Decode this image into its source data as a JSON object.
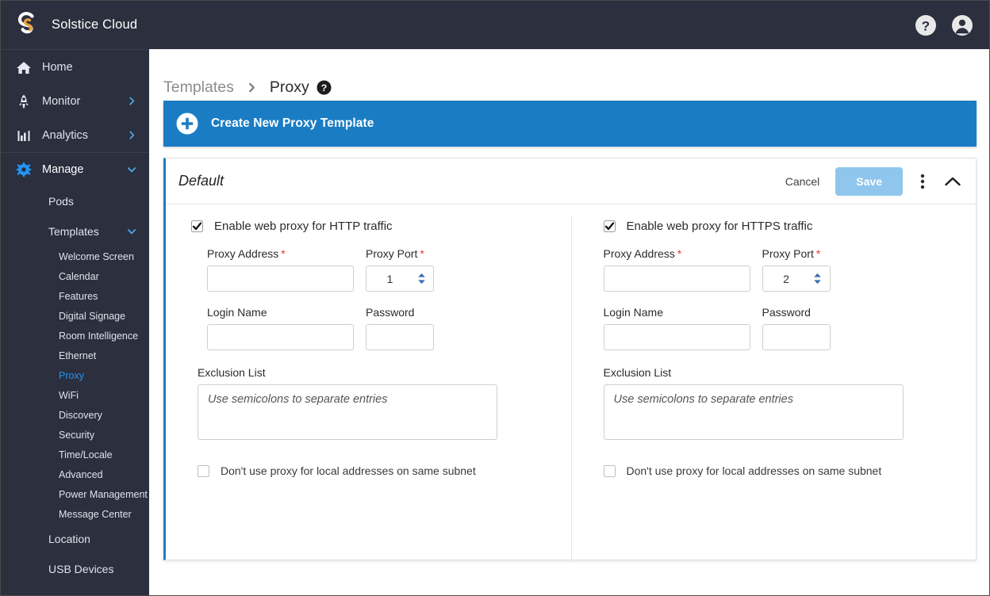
{
  "app": {
    "brand_name": "Solstice Cloud",
    "logo_icon": "solstice-s-logo",
    "help_icon": "question-circle-icon",
    "account_icon": "user-account-icon"
  },
  "colors": {
    "sidebar_bg": "#2b2f3e",
    "accent_blue": "#1a7dc4",
    "link_blue": "#2196f3",
    "save_blue": "#90c6ed",
    "required_red": "#e53935",
    "logo_orange": "#e8a33d"
  },
  "sidebar": {
    "items": [
      {
        "label": "Home",
        "icon": "home-icon",
        "caret": "none",
        "level": "top"
      },
      {
        "label": "Monitor",
        "icon": "rocket-icon",
        "caret": "right",
        "level": "top"
      },
      {
        "label": "Analytics",
        "icon": "bar-chart-icon",
        "caret": "right",
        "level": "top"
      },
      {
        "label": "Manage",
        "icon": "gear-icon",
        "caret": "down",
        "level": "top"
      }
    ],
    "manage_children": [
      {
        "label": "Pods",
        "caret": "none"
      },
      {
        "label": "Templates",
        "caret": "down"
      }
    ],
    "template_children": [
      {
        "label": "Welcome Screen",
        "selected": false
      },
      {
        "label": "Calendar",
        "selected": false
      },
      {
        "label": "Features",
        "selected": false
      },
      {
        "label": "Digital Signage",
        "selected": false
      },
      {
        "label": "Room Intelligence",
        "selected": false
      },
      {
        "label": "Ethernet",
        "selected": false
      },
      {
        "label": "Proxy",
        "selected": true
      },
      {
        "label": "WiFi",
        "selected": false
      },
      {
        "label": "Discovery",
        "selected": false
      },
      {
        "label": "Security",
        "selected": false
      },
      {
        "label": "Time/Locale",
        "selected": false
      },
      {
        "label": "Advanced",
        "selected": false
      },
      {
        "label": "Power Management",
        "selected": false
      },
      {
        "label": "Message Center",
        "selected": false
      }
    ],
    "manage_children_tail": [
      {
        "label": "Location"
      },
      {
        "label": "USB Devices"
      }
    ]
  },
  "breadcrumb": {
    "parent": "Templates",
    "separator_icon": "chevron-right-icon",
    "current": "Proxy",
    "help_icon": "help-question-icon"
  },
  "create_banner": {
    "label": "Create New Proxy Template",
    "icon": "plus-circle-icon"
  },
  "card": {
    "title": "Default",
    "cancel_label": "Cancel",
    "save_label": "Save",
    "kebab_icon": "more-vertical-icon",
    "collapse_icon": "chevron-up-icon"
  },
  "http_panel": {
    "enable_label": "Enable web proxy for HTTP traffic",
    "enabled": true,
    "proxy_address_label": "Proxy Address",
    "proxy_address_value": "",
    "proxy_port_label": "Proxy Port",
    "proxy_port_value": "1",
    "login_name_label": "Login Name",
    "login_name_value": "",
    "password_label": "Password",
    "password_value": "",
    "exclusion_label": "Exclusion List",
    "exclusion_placeholder": "Use semicolons to separate entries",
    "exclusion_value": "",
    "subnet_label": "Don't use proxy for local addresses on same subnet",
    "subnet_checked": false,
    "required_marker": "*"
  },
  "https_panel": {
    "enable_label": "Enable web proxy for HTTPS traffic",
    "enabled": true,
    "proxy_address_label": "Proxy Address",
    "proxy_address_value": "",
    "proxy_port_label": "Proxy Port",
    "proxy_port_value": "2",
    "login_name_label": "Login Name",
    "login_name_value": "",
    "password_label": "Password",
    "password_value": "",
    "exclusion_label": "Exclusion List",
    "exclusion_placeholder": "Use semicolons to separate entries",
    "exclusion_value": "",
    "subnet_label": "Don't use proxy for local addresses on same subnet",
    "subnet_checked": false,
    "required_marker": "*"
  }
}
